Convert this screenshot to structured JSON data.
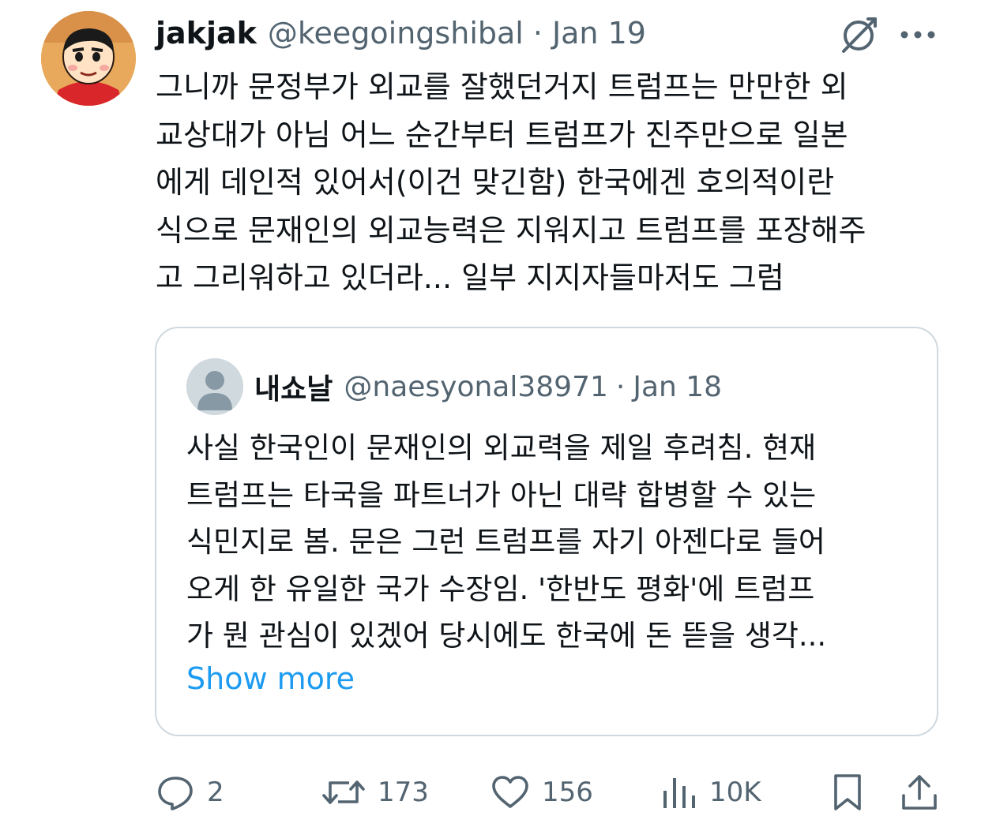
{
  "tweet": {
    "author_name": "jakjak",
    "author_handle": "@keegoingshibal",
    "separator": "·",
    "date": "Jan 19",
    "text": "그니까 문정부가 외교를 잘했던거지 트럼프는 만만한 외\n교상대가 아님 어느 순간부터 트럼프가 진주만으로 일본\n에게 데인적 있어서(이건 맞긴함) 한국에겐 호의적이란\n식으로 문재인의 외교능력은 지워지고 트럼프를 포장해주\n고 그리워하고 있더라... 일부 지지자들마저도 그럼"
  },
  "quoted": {
    "author_name": "내쇼날",
    "author_handle": "@naesyonal38971",
    "separator": "·",
    "date": "Jan 18",
    "text": "사실 한국인이 문재인의 외교력을 제일 후려침. 현재\n트럼프는 타국을 파트너가 아닌 대략 합병할 수 있는\n식민지로 봄. 문은 그런 트럼프를 자기 아젠다로 들어\n오게 한 유일한 국가 수장임. '한반도 평화'에 트럼프\n가 뭔 관심이 있겠어 당시에도 한국에 돈 뜯을 생각...",
    "show_more": "Show more"
  },
  "actions": {
    "replies": "2",
    "reposts": "173",
    "likes": "156",
    "views": "10K"
  },
  "icons": [
    "grok-icon",
    "more-icon",
    "reply-icon",
    "repost-icon",
    "like-icon",
    "views-icon",
    "bookmark-icon",
    "share-icon"
  ],
  "colors": {
    "text": "#0f1419",
    "secondary": "#536471",
    "link": "#1d9bf0",
    "border": "#cfd9de"
  }
}
